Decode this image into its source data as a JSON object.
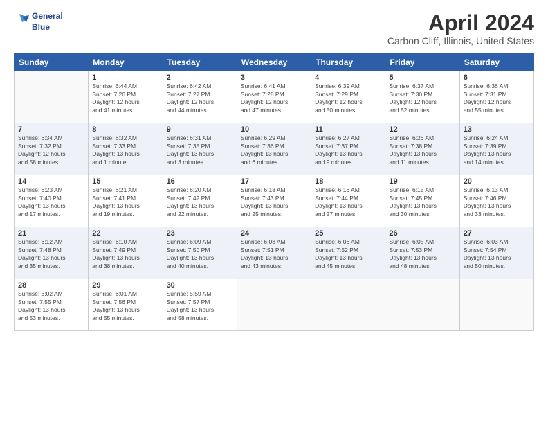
{
  "header": {
    "logo_line1": "General",
    "logo_line2": "Blue",
    "title": "April 2024",
    "location": "Carbon Cliff, Illinois, United States"
  },
  "days_of_week": [
    "Sunday",
    "Monday",
    "Tuesday",
    "Wednesday",
    "Thursday",
    "Friday",
    "Saturday"
  ],
  "weeks": [
    [
      {
        "day": "",
        "info": ""
      },
      {
        "day": "1",
        "info": "Sunrise: 6:44 AM\nSunset: 7:26 PM\nDaylight: 12 hours\nand 41 minutes."
      },
      {
        "day": "2",
        "info": "Sunrise: 6:42 AM\nSunset: 7:27 PM\nDaylight: 12 hours\nand 44 minutes."
      },
      {
        "day": "3",
        "info": "Sunrise: 6:41 AM\nSunset: 7:28 PM\nDaylight: 12 hours\nand 47 minutes."
      },
      {
        "day": "4",
        "info": "Sunrise: 6:39 AM\nSunset: 7:29 PM\nDaylight: 12 hours\nand 50 minutes."
      },
      {
        "day": "5",
        "info": "Sunrise: 6:37 AM\nSunset: 7:30 PM\nDaylight: 12 hours\nand 52 minutes."
      },
      {
        "day": "6",
        "info": "Sunrise: 6:36 AM\nSunset: 7:31 PM\nDaylight: 12 hours\nand 55 minutes."
      }
    ],
    [
      {
        "day": "7",
        "info": "Sunrise: 6:34 AM\nSunset: 7:32 PM\nDaylight: 12 hours\nand 58 minutes."
      },
      {
        "day": "8",
        "info": "Sunrise: 6:32 AM\nSunset: 7:33 PM\nDaylight: 13 hours\nand 1 minute."
      },
      {
        "day": "9",
        "info": "Sunrise: 6:31 AM\nSunset: 7:35 PM\nDaylight: 13 hours\nand 3 minutes."
      },
      {
        "day": "10",
        "info": "Sunrise: 6:29 AM\nSunset: 7:36 PM\nDaylight: 13 hours\nand 6 minutes."
      },
      {
        "day": "11",
        "info": "Sunrise: 6:27 AM\nSunset: 7:37 PM\nDaylight: 13 hours\nand 9 minutes."
      },
      {
        "day": "12",
        "info": "Sunrise: 6:26 AM\nSunset: 7:38 PM\nDaylight: 13 hours\nand 11 minutes."
      },
      {
        "day": "13",
        "info": "Sunrise: 6:24 AM\nSunset: 7:39 PM\nDaylight: 13 hours\nand 14 minutes."
      }
    ],
    [
      {
        "day": "14",
        "info": "Sunrise: 6:23 AM\nSunset: 7:40 PM\nDaylight: 13 hours\nand 17 minutes."
      },
      {
        "day": "15",
        "info": "Sunrise: 6:21 AM\nSunset: 7:41 PM\nDaylight: 13 hours\nand 19 minutes."
      },
      {
        "day": "16",
        "info": "Sunrise: 6:20 AM\nSunset: 7:42 PM\nDaylight: 13 hours\nand 22 minutes."
      },
      {
        "day": "17",
        "info": "Sunrise: 6:18 AM\nSunset: 7:43 PM\nDaylight: 13 hours\nand 25 minutes."
      },
      {
        "day": "18",
        "info": "Sunrise: 6:16 AM\nSunset: 7:44 PM\nDaylight: 13 hours\nand 27 minutes."
      },
      {
        "day": "19",
        "info": "Sunrise: 6:15 AM\nSunset: 7:45 PM\nDaylight: 13 hours\nand 30 minutes."
      },
      {
        "day": "20",
        "info": "Sunrise: 6:13 AM\nSunset: 7:46 PM\nDaylight: 13 hours\nand 33 minutes."
      }
    ],
    [
      {
        "day": "21",
        "info": "Sunrise: 6:12 AM\nSunset: 7:48 PM\nDaylight: 13 hours\nand 35 minutes."
      },
      {
        "day": "22",
        "info": "Sunrise: 6:10 AM\nSunset: 7:49 PM\nDaylight: 13 hours\nand 38 minutes."
      },
      {
        "day": "23",
        "info": "Sunrise: 6:09 AM\nSunset: 7:50 PM\nDaylight: 13 hours\nand 40 minutes."
      },
      {
        "day": "24",
        "info": "Sunrise: 6:08 AM\nSunset: 7:51 PM\nDaylight: 13 hours\nand 43 minutes."
      },
      {
        "day": "25",
        "info": "Sunrise: 6:06 AM\nSunset: 7:52 PM\nDaylight: 13 hours\nand 45 minutes."
      },
      {
        "day": "26",
        "info": "Sunrise: 6:05 AM\nSunset: 7:53 PM\nDaylight: 13 hours\nand 48 minutes."
      },
      {
        "day": "27",
        "info": "Sunrise: 6:03 AM\nSunset: 7:54 PM\nDaylight: 13 hours\nand 50 minutes."
      }
    ],
    [
      {
        "day": "28",
        "info": "Sunrise: 6:02 AM\nSunset: 7:55 PM\nDaylight: 13 hours\nand 53 minutes."
      },
      {
        "day": "29",
        "info": "Sunrise: 6:01 AM\nSunset: 7:56 PM\nDaylight: 13 hours\nand 55 minutes."
      },
      {
        "day": "30",
        "info": "Sunrise: 5:59 AM\nSunset: 7:57 PM\nDaylight: 13 hours\nand 58 minutes."
      },
      {
        "day": "",
        "info": ""
      },
      {
        "day": "",
        "info": ""
      },
      {
        "day": "",
        "info": ""
      },
      {
        "day": "",
        "info": ""
      }
    ]
  ]
}
